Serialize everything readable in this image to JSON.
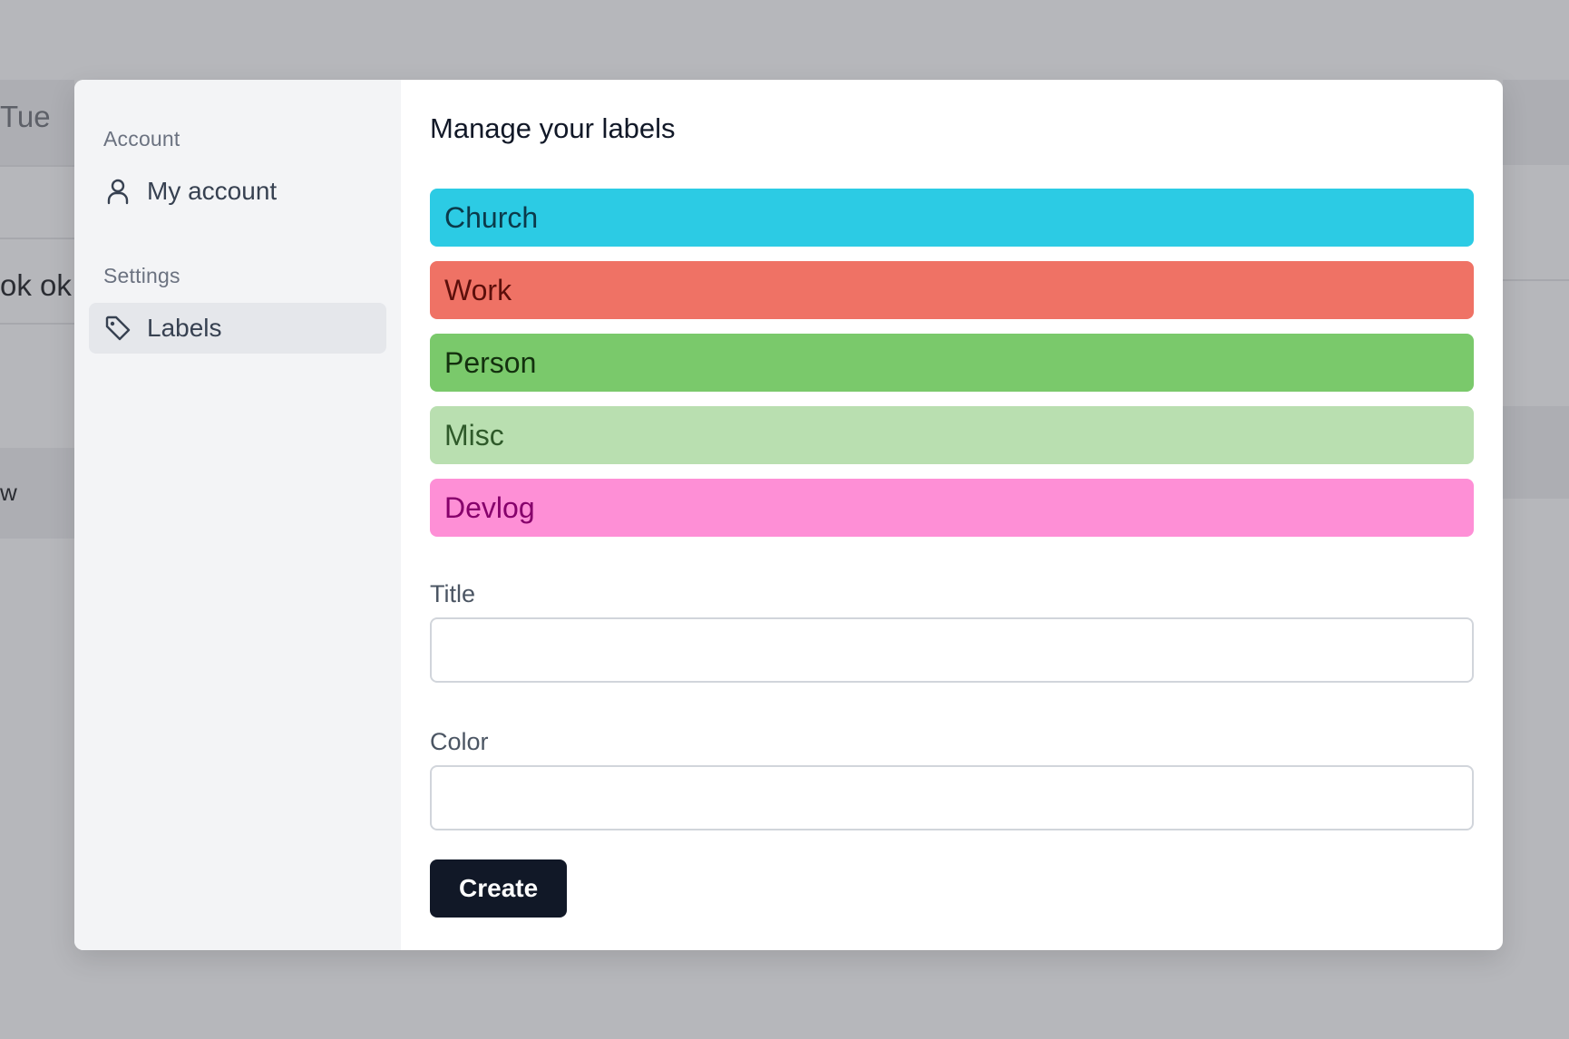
{
  "background": {
    "fragments": [
      "Tue",
      "ok ok",
      "w"
    ]
  },
  "sidebar": {
    "account_heading": "Account",
    "my_account_label": "My account",
    "settings_heading": "Settings",
    "labels_label": "Labels"
  },
  "main": {
    "title": "Manage your labels",
    "labels": [
      {
        "name": "Church",
        "bg": "#2ccbe4",
        "fg": "#0b3a4a"
      },
      {
        "name": "Work",
        "bg": "#ef7265",
        "fg": "#5c0f0b"
      },
      {
        "name": "Person",
        "bg": "#7ac96b",
        "fg": "#13300e"
      },
      {
        "name": "Misc",
        "bg": "#b9dfb0",
        "fg": "#2f5a2a"
      },
      {
        "name": "Devlog",
        "bg": "#fe8fd6",
        "fg": "#86006b"
      }
    ],
    "form": {
      "title_label": "Title",
      "title_value": "",
      "color_label": "Color",
      "color_value": "",
      "create_label": "Create"
    }
  }
}
